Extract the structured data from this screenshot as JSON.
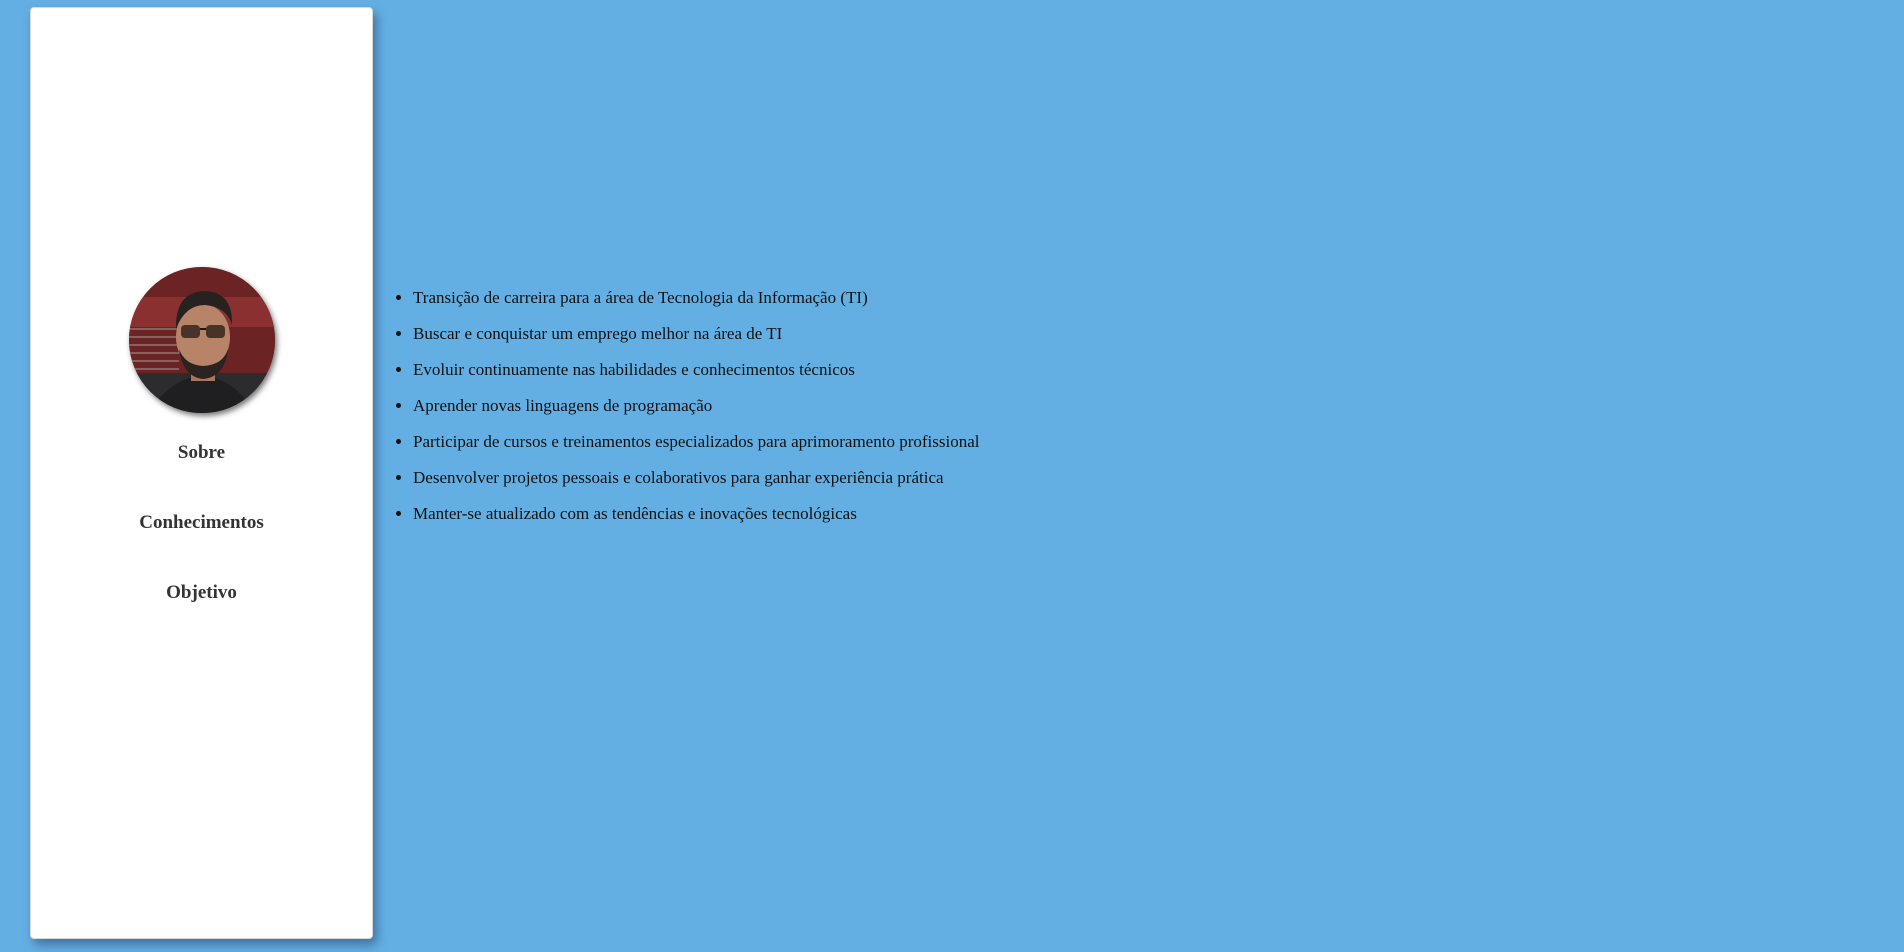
{
  "sidebar": {
    "avatar_alt": "Foto de perfil",
    "nav_items": [
      "Sobre",
      "Conhecimentos",
      "Objetivo"
    ]
  },
  "main": {
    "objectives": [
      "Transição de carreira para a área de Tecnologia da Informação (TI)",
      "Buscar e conquistar um emprego melhor na área de TI",
      "Evoluir continuamente nas habilidades e conhecimentos técnicos",
      "Aprender novas linguagens de programação",
      "Participar de cursos e treinamentos especializados para aprimoramento profissional",
      "Desenvolver projetos pessoais e colaborativos para ganhar experiência prática",
      "Manter-se atualizado com as tendências e inovações tecnológicas"
    ]
  },
  "colors": {
    "page_background": "#63afe3",
    "sidebar_background": "#ffffff",
    "nav_text": "#333333"
  }
}
